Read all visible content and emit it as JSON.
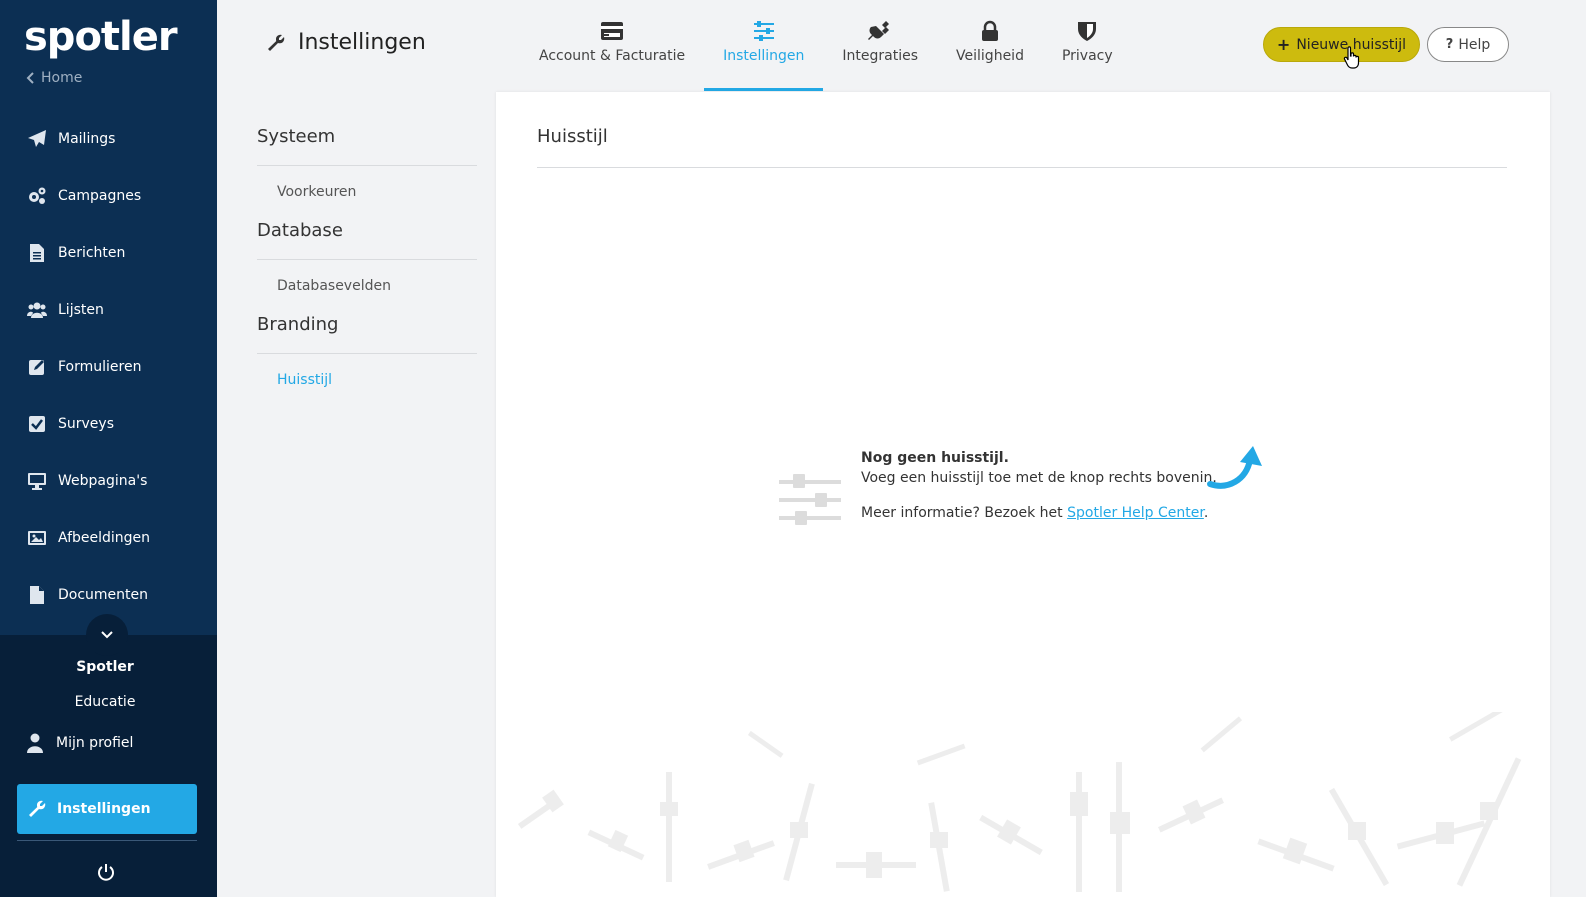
{
  "sidebar": {
    "logo": "spotler",
    "home_label": "Home",
    "items": [
      {
        "label": "Mailings",
        "icon": "paper-plane-icon"
      },
      {
        "label": "Campagnes",
        "icon": "gears-icon"
      },
      {
        "label": "Berichten",
        "icon": "document-lines-icon"
      },
      {
        "label": "Lijsten",
        "icon": "users-icon"
      },
      {
        "label": "Formulieren",
        "icon": "edit-form-icon"
      },
      {
        "label": "Surveys",
        "icon": "checkbox-icon"
      },
      {
        "label": "Webpagina's",
        "icon": "monitor-icon"
      },
      {
        "label": "Afbeeldingen",
        "icon": "image-icon"
      },
      {
        "label": "Documenten",
        "icon": "file-icon"
      }
    ],
    "org_name": "Spotler",
    "org_sub": "Educatie",
    "profile_label": "Mijn profiel",
    "settings_label": "Instellingen"
  },
  "header": {
    "title": "Instellingen",
    "tabs": [
      {
        "label": "Account & Facturatie",
        "icon": "credit-card-icon"
      },
      {
        "label": "Instellingen",
        "icon": "sliders-icon",
        "active": true
      },
      {
        "label": "Integraties",
        "icon": "plug-icon"
      },
      {
        "label": "Veiligheid",
        "icon": "lock-icon"
      },
      {
        "label": "Privacy",
        "icon": "shield-icon"
      }
    ],
    "new_button_label": "Nieuwe huisstijl",
    "help_button_label": "Help"
  },
  "submenu": {
    "sections": [
      {
        "heading": "Systeem",
        "items": [
          "Voorkeuren"
        ]
      },
      {
        "heading": "Database",
        "items": [
          "Databasevelden"
        ]
      },
      {
        "heading": "Branding",
        "items": [
          "Huisstijl"
        ]
      }
    ],
    "active_item": "Huisstijl"
  },
  "panel": {
    "title": "Huisstijl",
    "empty_title": "Nog geen huisstijl.",
    "empty_desc": "Voeg een huisstijl toe met de knop rechts bovenin.",
    "more_prefix": "Meer informatie? Bezoek het ",
    "more_link": "Spotler Help Center",
    "more_suffix": "."
  },
  "colors": {
    "sidebar_bg": "#0c2f53",
    "accent": "#23a8e5",
    "new_button": "#cdbb0e"
  }
}
